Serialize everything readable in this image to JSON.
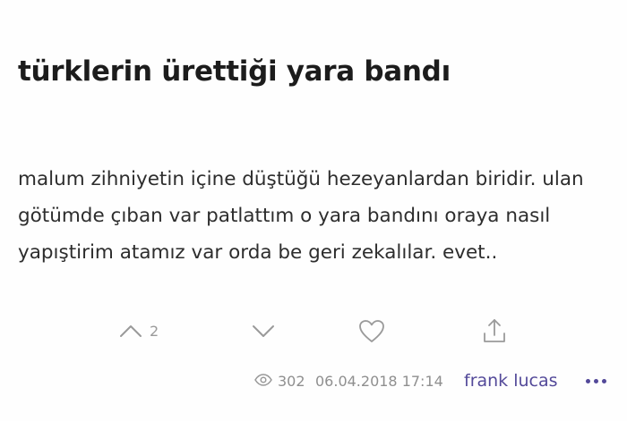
{
  "topic": {
    "title": "türklerin ürettiği yara bandı"
  },
  "entry": {
    "text": "malum zihniyetin içine düştüğü hezeyanlardan biridir. ulan götümde çıban var patlattım o yara bandını oraya nasıl yapıştirim atamız var orda be geri zekalılar. evet..",
    "upvote_count": "2",
    "views": "302",
    "date": "06.04.2018 17:14",
    "author": "frank lucas"
  },
  "icons": {
    "upvote": "chevron-up-icon",
    "downvote": "chevron-down-icon",
    "favorite": "heart-icon",
    "share": "share-icon",
    "views": "eye-icon",
    "more": "more-dots-icon"
  },
  "colors": {
    "author": "#534999",
    "icons": "#9a9a9a",
    "title": "#1c1c1c"
  }
}
